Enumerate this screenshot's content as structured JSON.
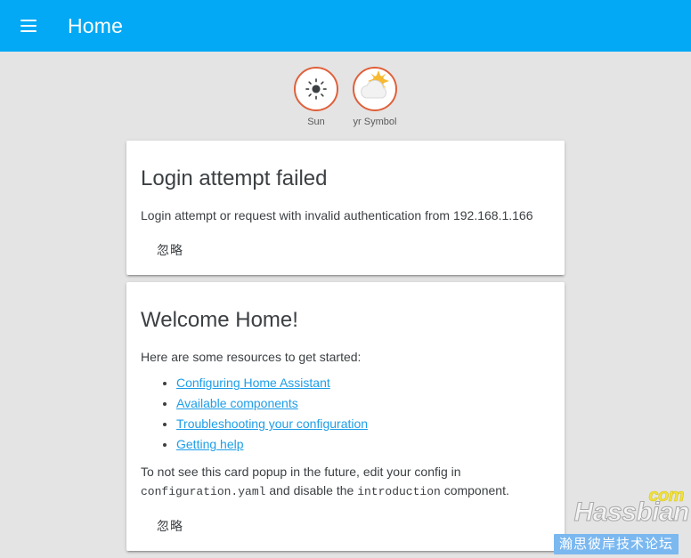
{
  "toolbar": {
    "menu_icon": "hamburger-menu-icon",
    "title": "Home"
  },
  "badges": [
    {
      "label": "Sun",
      "icon": "sun-icon"
    },
    {
      "label": "yr Symbol",
      "icon": "sun-behind-cloud-icon"
    }
  ],
  "cards": [
    {
      "id": "login-attempt-failed",
      "title": "Login attempt failed",
      "body_text": "Login attempt or request with invalid authentication from 192.168.1.166",
      "dismiss_label": "忽略"
    },
    {
      "id": "welcome-home",
      "title": "Welcome Home!",
      "intro": "Here are some resources to get started:",
      "links": [
        "Configuring Home Assistant",
        "Available components",
        "Troubleshooting your configuration",
        "Getting help"
      ],
      "footer_prefix": "To not see this card popup in the future, edit your config in ",
      "footer_code_1": "configuration.yaml",
      "footer_middle": " and disable the ",
      "footer_code_2": "introduction",
      "footer_suffix": " component.",
      "dismiss_label": "忽略"
    }
  ],
  "watermark": {
    "tld": "com",
    "name": "Hassbian",
    "chinese": "瀚思彼岸技术论坛"
  },
  "colors": {
    "toolbar": "#03a9f4",
    "background": "#e4e4e4",
    "card": "#ffffff",
    "link": "#1e9ee8",
    "badge_ring": "#e0603a",
    "watermark_bar": "#7bb8f0",
    "watermark_tld": "#f2e23a"
  }
}
